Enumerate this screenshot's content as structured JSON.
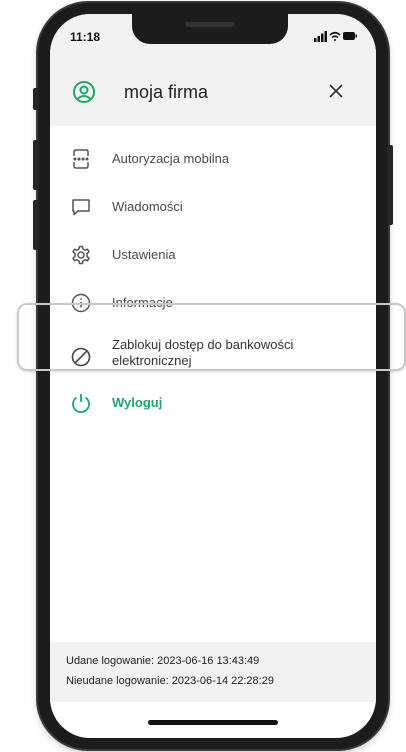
{
  "status_bar": {
    "time": "11:18"
  },
  "header": {
    "title": "moja firma",
    "user_icon": "user-circle-icon",
    "close_icon": "close-icon"
  },
  "menu": {
    "items": [
      {
        "label": "Autoryzacja mobilna",
        "icon": "mobile-authorization-icon"
      },
      {
        "label": "Wiadomości",
        "icon": "message-icon"
      },
      {
        "label": "Ustawienia",
        "icon": "gear-icon"
      },
      {
        "label": "Informacje",
        "icon": "info-icon"
      },
      {
        "label": "Zablokuj dostęp do bankowości elektronicznej",
        "icon": "block-icon"
      },
      {
        "label": "Wyloguj",
        "icon": "power-icon"
      }
    ]
  },
  "footer": {
    "success_login": "Udane logowanie: 2023-06-16 13:43:49",
    "failed_login": "Nieudane logowanie: 2023-06-14 22:28:29"
  },
  "colors": {
    "accent_green": "#1aa86b",
    "panel_gray": "#f2f2f2",
    "text_gray": "#4a4a4a"
  }
}
